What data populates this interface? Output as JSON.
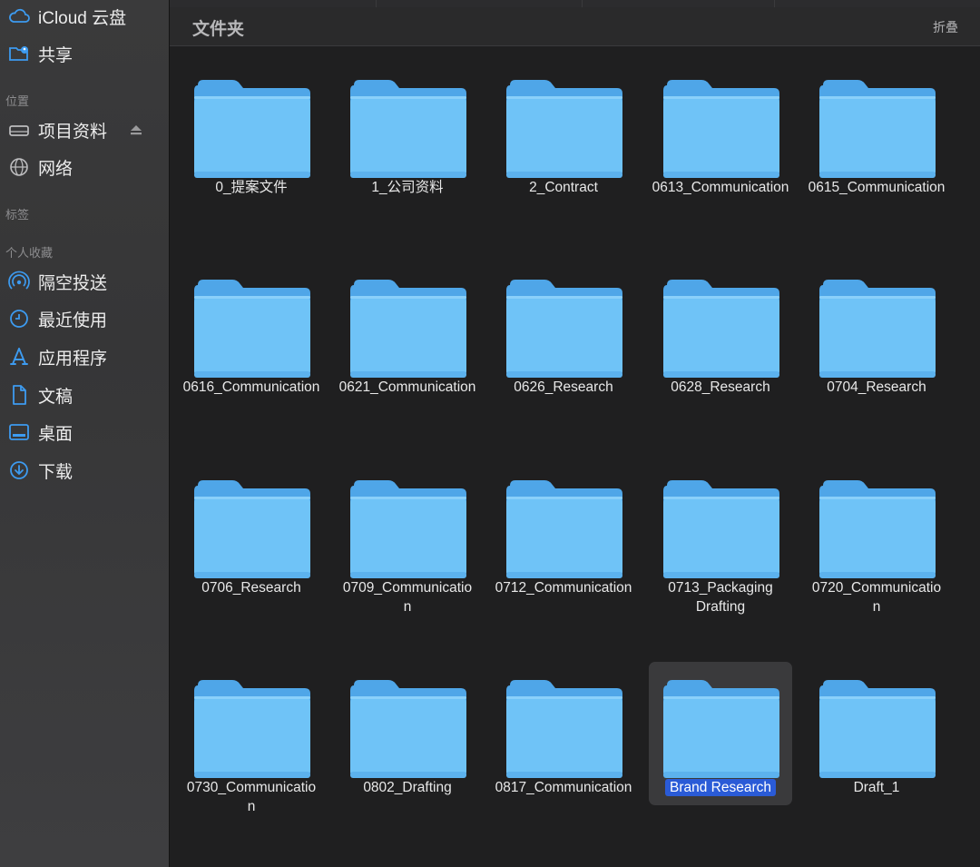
{
  "sidebar": {
    "items": [
      {
        "label": "iCloud 云盘",
        "icon": "cloud-icon"
      },
      {
        "label": "共享",
        "icon": "shared-folder-icon"
      }
    ],
    "section_locations": "位置",
    "locations": [
      {
        "label": "项目资料",
        "icon": "drive-icon",
        "eject_icon": "eject-icon"
      },
      {
        "label": "网络",
        "icon": "globe-icon"
      }
    ],
    "section_tags": "标签",
    "section_favorites": "个人收藏",
    "favorites": [
      {
        "label": "隔空投送",
        "icon": "airdrop-icon"
      },
      {
        "label": "最近使用",
        "icon": "clock-icon"
      },
      {
        "label": "应用程序",
        "icon": "apps-icon"
      },
      {
        "label": "文稿",
        "icon": "document-icon"
      },
      {
        "label": "桌面",
        "icon": "desktop-icon"
      },
      {
        "label": "下载",
        "icon": "download-icon"
      }
    ]
  },
  "main": {
    "title": "文件夹",
    "collapse_label": "折叠",
    "folders": [
      {
        "name": "0_提案文件"
      },
      {
        "name": "1_公司资料"
      },
      {
        "name": "2_Contract"
      },
      {
        "name": "0613_Communication"
      },
      {
        "name": "0615_Communication"
      },
      {
        "name": "0616_Communication"
      },
      {
        "name": "0621_Communication"
      },
      {
        "name": "0626_Research"
      },
      {
        "name": "0628_Research"
      },
      {
        "name": "0704_Research"
      },
      {
        "name": "0706_Research"
      },
      {
        "name": "0709_Communicatio\nn"
      },
      {
        "name": "0712_Communication"
      },
      {
        "name": "0713_Packaging\nDrafting"
      },
      {
        "name": "0720_Communicatio\nn"
      },
      {
        "name": "0730_Communicatio\nn"
      },
      {
        "name": "0802_Drafting"
      },
      {
        "name": "0817_Communication"
      },
      {
        "name": "Brand Research",
        "selected": true
      },
      {
        "name": "Draft_1"
      }
    ]
  },
  "colors": {
    "accent": "#2a5bd7",
    "folder_front": "#6fc3f7",
    "folder_back": "#4fa6e8",
    "sidebar_icon": "#3d9bf0"
  }
}
